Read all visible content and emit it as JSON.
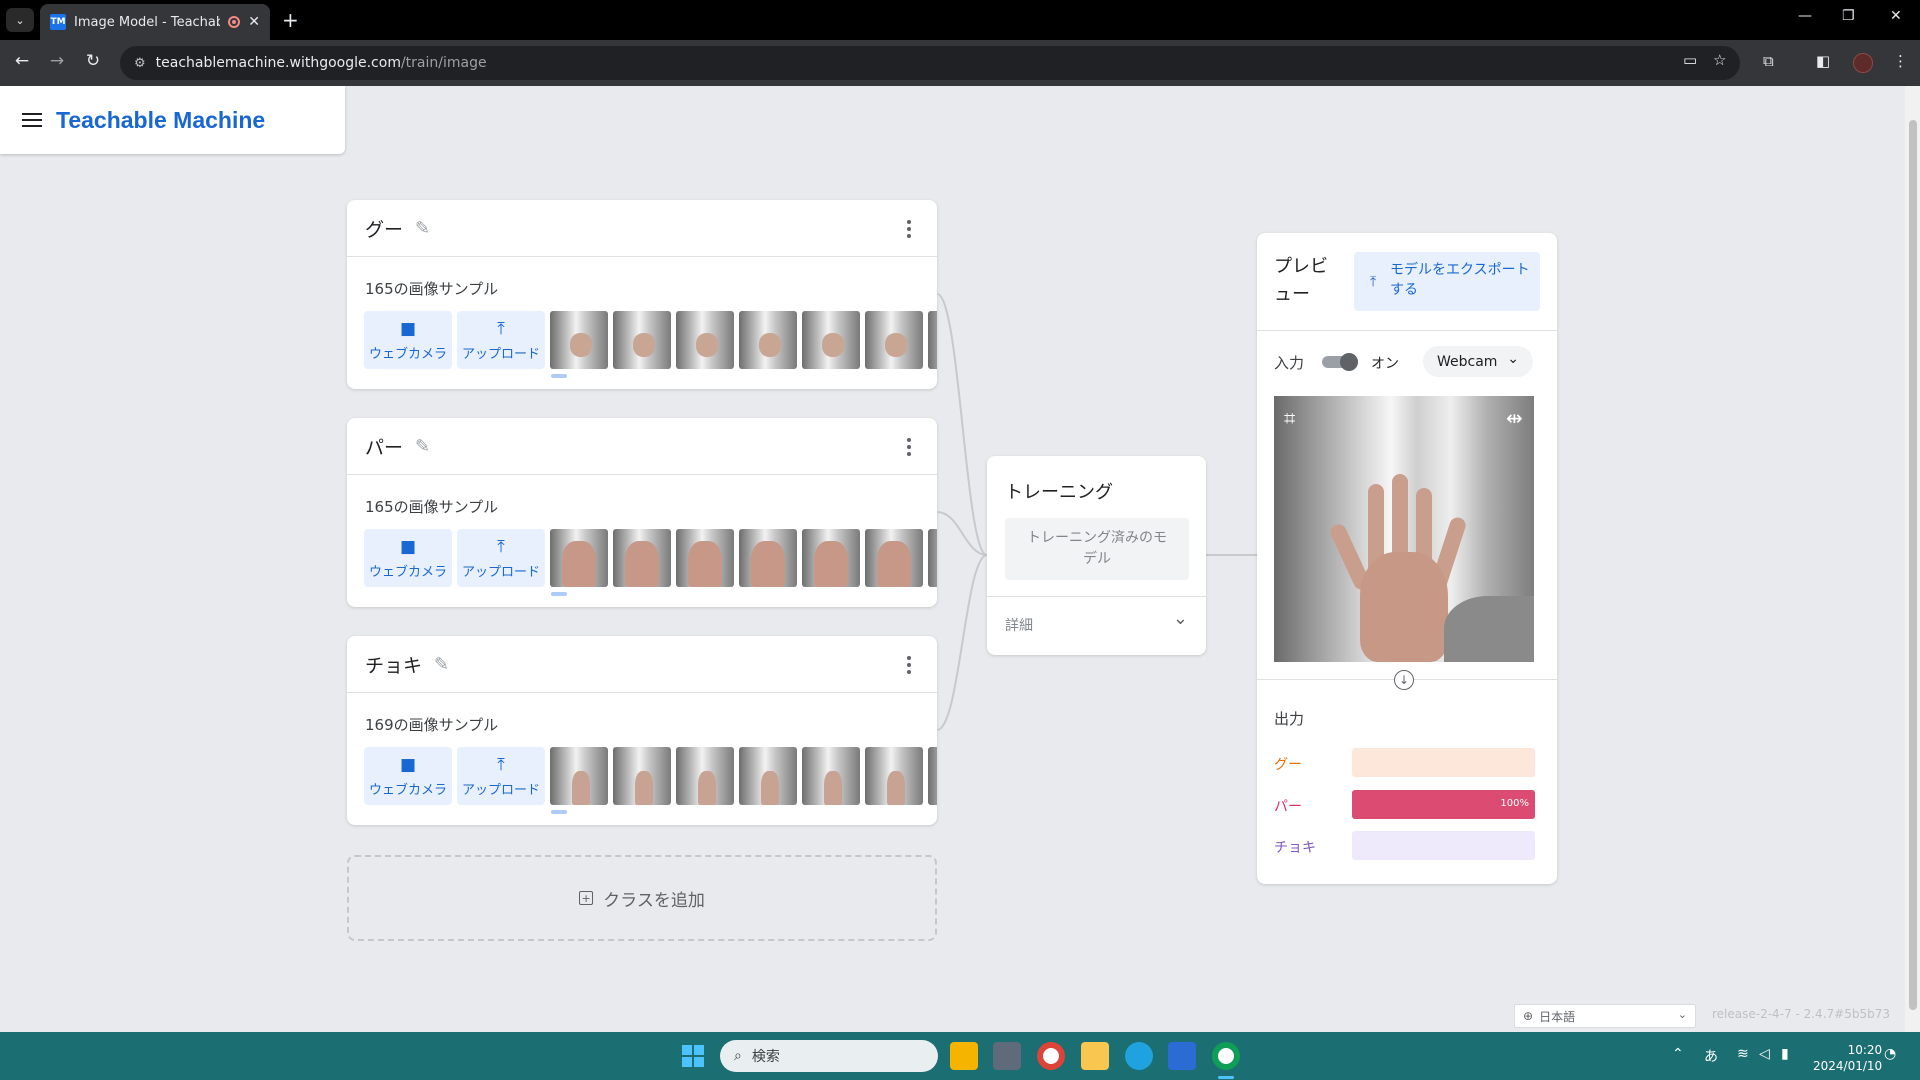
{
  "browser": {
    "tab_title": "Image Model - Teachable M",
    "favicon_text": "TM",
    "url_host": "teachablemachine.withgoogle.com",
    "url_path": "/train/image"
  },
  "app": {
    "brand": "Teachable Machine"
  },
  "classes": [
    {
      "name": "グー",
      "samples": "165の画像サンプル",
      "thumb_kind": "fist"
    },
    {
      "name": "パー",
      "samples": "165の画像サンプル",
      "thumb_kind": "palm"
    },
    {
      "name": "チョキ",
      "samples": "169の画像サンプル",
      "thumb_kind": "peace"
    }
  ],
  "sample_buttons": {
    "webcam": "ウェブカメラ",
    "upload": "アップロード"
  },
  "add_class": "クラスを追加",
  "training": {
    "title": "トレーニング",
    "button": "トレーニング済みのモデル",
    "advanced": "詳細"
  },
  "preview": {
    "title": "プレビュー",
    "export": "モデルをエクスポートする",
    "input_label": "入力",
    "toggle_state": "オン",
    "source": "Webcam",
    "output_label": "出力",
    "outputs": [
      {
        "name": "グー",
        "value": 0,
        "pct_label": "",
        "color": "#e8710a",
        "bg": "#fde7db",
        "fill": "#f6a26c"
      },
      {
        "name": "パー",
        "value": 1.0,
        "pct_label": "100%",
        "color": "#d93267",
        "bg": "#fbe0e8",
        "fill": "#db4b72"
      },
      {
        "name": "チョキ",
        "value": 0,
        "pct_label": "",
        "color": "#7e57c2",
        "bg": "#efeafb",
        "fill": "#9575cd"
      }
    ]
  },
  "footer": {
    "language": "日本語",
    "release": "release-2-4-7 - 2.4.7#5b5b73"
  },
  "taskbar": {
    "search_placeholder": "検索",
    "ime": "あ",
    "time": "10:20",
    "date": "2024/01/10"
  }
}
